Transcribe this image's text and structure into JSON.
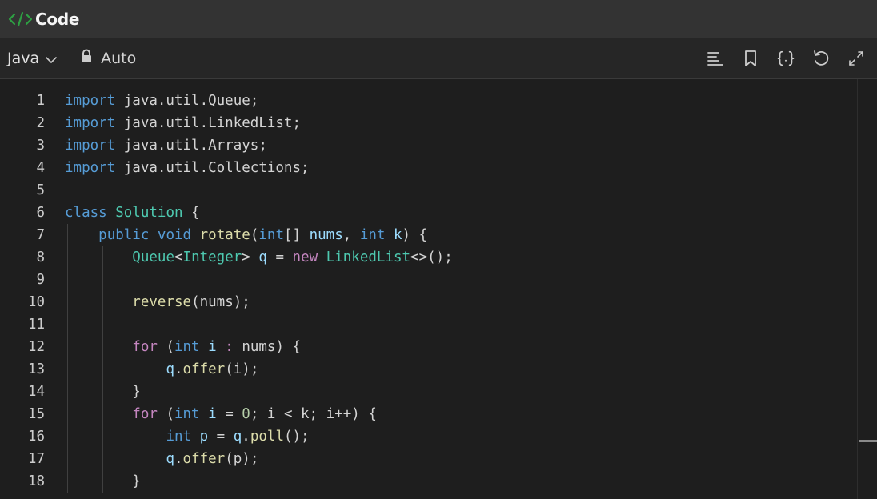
{
  "header": {
    "title": "Code"
  },
  "toolbar": {
    "language": "Java",
    "mode": "Auto",
    "tools": [
      "format-icon",
      "bookmark-icon",
      "braces-icon",
      "reset-icon",
      "expand-icon"
    ]
  },
  "colors": {
    "keyword": "#569cd6",
    "control": "#c586c0",
    "type": "#4ec9b0",
    "function": "#dcdcaa",
    "variable": "#9cdcfe",
    "number": "#b5cea8",
    "plain": "#d4d4d4",
    "accent": "#2ea043"
  },
  "editor": {
    "lines": [
      {
        "n": "1",
        "tokens": [
          [
            "kw",
            "import"
          ],
          [
            "pl",
            " java.util.Queue;"
          ]
        ]
      },
      {
        "n": "2",
        "tokens": [
          [
            "kw",
            "import"
          ],
          [
            "pl",
            " java.util.LinkedList;"
          ]
        ]
      },
      {
        "n": "3",
        "tokens": [
          [
            "kw",
            "import"
          ],
          [
            "pl",
            " java.util.Arrays;"
          ]
        ]
      },
      {
        "n": "4",
        "tokens": [
          [
            "kw",
            "import"
          ],
          [
            "pl",
            " java.util.Collections;"
          ]
        ]
      },
      {
        "n": "5",
        "tokens": []
      },
      {
        "n": "6",
        "tokens": [
          [
            "kw",
            "class"
          ],
          [
            "pl",
            " "
          ],
          [
            "typ",
            "Solution"
          ],
          [
            "pl",
            " {"
          ]
        ]
      },
      {
        "n": "7",
        "tokens": [
          [
            "pl",
            "    "
          ],
          [
            "kw",
            "public"
          ],
          [
            "pl",
            " "
          ],
          [
            "kw",
            "void"
          ],
          [
            "pl",
            " "
          ],
          [
            "fn",
            "rotate"
          ],
          [
            "pl",
            "("
          ],
          [
            "kw",
            "int"
          ],
          [
            "pl",
            "[] "
          ],
          [
            "var",
            "nums"
          ],
          [
            "pl",
            ", "
          ],
          [
            "kw",
            "int"
          ],
          [
            "pl",
            " "
          ],
          [
            "var",
            "k"
          ],
          [
            "pl",
            ") {"
          ]
        ]
      },
      {
        "n": "8",
        "tokens": [
          [
            "pl",
            "        "
          ],
          [
            "typ",
            "Queue"
          ],
          [
            "pl",
            "<"
          ],
          [
            "typ",
            "Integer"
          ],
          [
            "pl",
            "> "
          ],
          [
            "var",
            "q"
          ],
          [
            "pl",
            " = "
          ],
          [
            "kw2",
            "new"
          ],
          [
            "pl",
            " "
          ],
          [
            "typ",
            "LinkedList"
          ],
          [
            "pl",
            "<>();"
          ]
        ]
      },
      {
        "n": "9",
        "tokens": []
      },
      {
        "n": "10",
        "tokens": [
          [
            "pl",
            "        "
          ],
          [
            "fn",
            "reverse"
          ],
          [
            "pl",
            "(nums);"
          ]
        ]
      },
      {
        "n": "11",
        "tokens": []
      },
      {
        "n": "12",
        "tokens": [
          [
            "pl",
            "        "
          ],
          [
            "kw2",
            "for"
          ],
          [
            "pl",
            " ("
          ],
          [
            "kw",
            "int"
          ],
          [
            "pl",
            " "
          ],
          [
            "var",
            "i"
          ],
          [
            "pl",
            " "
          ],
          [
            "kw2",
            ":"
          ],
          [
            "pl",
            " nums) {"
          ]
        ]
      },
      {
        "n": "13",
        "tokens": [
          [
            "pl",
            "            "
          ],
          [
            "var",
            "q"
          ],
          [
            "pl",
            "."
          ],
          [
            "fn",
            "offer"
          ],
          [
            "pl",
            "(i);"
          ]
        ]
      },
      {
        "n": "14",
        "tokens": [
          [
            "pl",
            "        }"
          ]
        ]
      },
      {
        "n": "15",
        "tokens": [
          [
            "pl",
            "        "
          ],
          [
            "kw2",
            "for"
          ],
          [
            "pl",
            " ("
          ],
          [
            "kw",
            "int"
          ],
          [
            "pl",
            " "
          ],
          [
            "var",
            "i"
          ],
          [
            "pl",
            " = "
          ],
          [
            "num",
            "0"
          ],
          [
            "pl",
            "; i < k; i++) {"
          ]
        ]
      },
      {
        "n": "16",
        "tokens": [
          [
            "pl",
            "            "
          ],
          [
            "kw",
            "int"
          ],
          [
            "pl",
            " "
          ],
          [
            "var",
            "p"
          ],
          [
            "pl",
            " = "
          ],
          [
            "var",
            "q"
          ],
          [
            "pl",
            "."
          ],
          [
            "fn",
            "poll"
          ],
          [
            "pl",
            "();"
          ]
        ]
      },
      {
        "n": "17",
        "tokens": [
          [
            "pl",
            "            "
          ],
          [
            "var",
            "q"
          ],
          [
            "pl",
            "."
          ],
          [
            "fn",
            "offer"
          ],
          [
            "pl",
            "(p);"
          ]
        ]
      },
      {
        "n": "18",
        "tokens": [
          [
            "pl",
            "        }"
          ]
        ]
      }
    ]
  }
}
